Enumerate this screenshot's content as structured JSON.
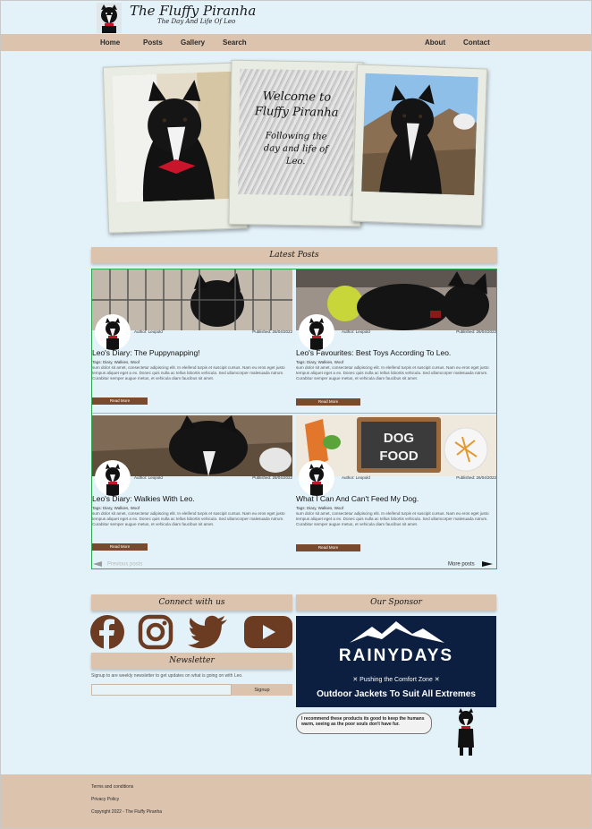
{
  "site": {
    "title": "The Fluffy Piranha",
    "subtitle": "The Day And Life Of Leo",
    "logo_icon": "dog-logo-icon"
  },
  "nav": {
    "left": [
      "Home",
      "Posts",
      "Gallery",
      "Search"
    ],
    "right": [
      "About",
      "Contact"
    ]
  },
  "hero": {
    "welcome_line1": "Welcome to",
    "welcome_line2": "Fluffy Piranha",
    "tagline_line1": "Following the",
    "tagline_line2": "day and life of",
    "tagline_line3": "Leo."
  },
  "latest": {
    "heading": "Latest Posts"
  },
  "posts": [
    {
      "author": "Author: Leopold",
      "published": "Published: 26/04/2022",
      "title": "Leo's Diary: The Puppynapping!",
      "tags": "Tags: Diary, Walkies, Woof",
      "excerpt": "sum dolor sit amet, consectetur adipiscing elit. In eleifend turpis et suscipit cursus. Nam eu eros eget justo tempus aliquet eget a ex. Donec quis nulla ac tellus lobortis vehicula. Sed ullamcorper malesuada rutrum. Curabitur semper augue metus, et vehicula diam faucibus sit amet.",
      "read_more": "Read More"
    },
    {
      "author": "Author: Leopold",
      "published": "Published: 26/04/2022",
      "title": "Leo's Favourites: Best Toys According To Leo.",
      "tags": "Tags: Diary, Walkies, Woof",
      "excerpt": "sum dolor sit amet, consectetur adipiscing elit. In eleifend turpis et suscipit cursus. Nam eu eros eget justo tempus aliquet eget a ex. Donec quis nulla ac tellus lobortis vehicula. Sed ullamcorper malesuada rutrum. Curabitur semper augue metus, et vehicula diam faucibus sit amet.",
      "read_more": "Read More"
    },
    {
      "author": "Author: Leopold",
      "published": "Published: 26/04/2022",
      "title": "Leo's Diary: Walkies With Leo.",
      "tags": "Tags: Diary, Walkies, Woof",
      "excerpt": "sum dolor sit amet, consectetur adipiscing elit. In eleifend turpis et suscipit cursus. Nam eu eros eget justo tempus aliquet eget a ex. Donec quis nulla ac tellus lobortis vehicula. Sed ullamcorper malesuada rutrum. Curabitur semper augue metus, et vehicula diam faucibus sit amet.",
      "read_more": "Read More"
    },
    {
      "author": "Author: Leopold",
      "published": "Published: 26/04/2022",
      "title": "What I Can And Can't Feed My Dog.",
      "tags": "Tags: Diary, Walkies, Woof",
      "excerpt": "sum dolor sit amet, consectetur adipiscing elit. In eleifend turpis et suscipit cursus. Nam eu eros eget justo tempus aliquet eget a ex. Donec quis nulla ac tellus lobortis vehicula. Sed ullamcorper malesuada rutrum. Curabitur semper augue metus, et vehicula diam faucibus sit amet.",
      "read_more": "Read More",
      "image_text_1": "DOG",
      "image_text_2": "FOOD"
    }
  ],
  "pager": {
    "prev": "Previous posts",
    "next": "More posts"
  },
  "connect": {
    "heading": "Connect with us",
    "icons": [
      "facebook-icon",
      "instagram-icon",
      "twitter-icon",
      "youtube-icon"
    ]
  },
  "newsletter": {
    "heading": "Newsletter",
    "text": "Signup to are weekly newsletter to get updates on what is going on with Leo.",
    "input_value": "",
    "button": "Signup"
  },
  "sponsor": {
    "heading": "Our Sponsor",
    "brand": "RAINYDAYS",
    "slogan": "✕ Pushing the Comfort Zone ✕",
    "offer": "Outdoor Jackets To Suit All Extremes",
    "recommendation": "I recommend these products its good to keep the humans warm, seeing as the poor souls don't have fur."
  },
  "footer": {
    "terms": "Terms and conditions",
    "privacy": "Privacy Policy",
    "copyright": "Copyright 2022 - The Fluffy Piranha"
  },
  "colors": {
    "page_bg": "#e3f1f9",
    "accent_tan": "#dcc3ad",
    "brown": "#7a4a2e",
    "social": "#6b3b22",
    "posts_border": "#2fa84f",
    "sponsor_bg": "#0c1f40"
  }
}
